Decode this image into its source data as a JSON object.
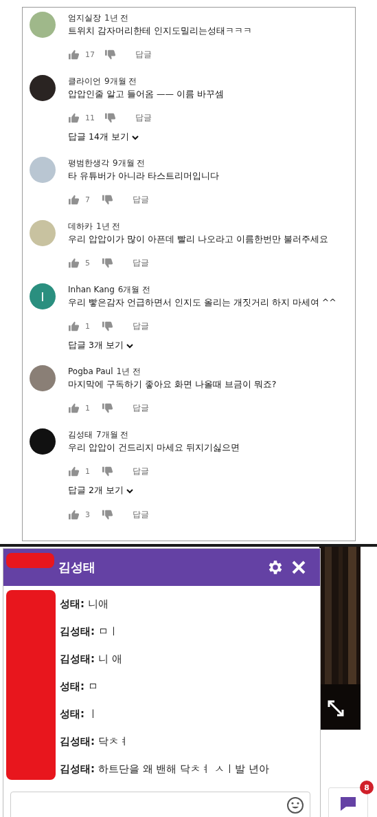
{
  "comments": [
    {
      "author": "엄지실장",
      "time": "1년 전",
      "text": "트위치 감자머리한테 인지도밀리는성태ㅋㅋㅋ",
      "avatar": {
        "color": "#9fb88a"
      },
      "likes": "17",
      "reply": "답글"
    },
    {
      "author": "클라이언",
      "time": "9개월 전",
      "text": "압압인줄 알고 들어옴 —— 이름 바꾸셈",
      "avatar": {
        "color": "#2a2422"
      },
      "likes": "11",
      "reply": "답글",
      "replies": "답글 14개 보기"
    },
    {
      "author": "평범한생각",
      "time": "9개월 전",
      "text": "타 유튜버가 아니라 타스트리머입니다",
      "avatar": {
        "color": "#b9c6d2"
      },
      "likes": "7",
      "reply": "답글"
    },
    {
      "author": "데하카",
      "time": "1년 전",
      "text": "우리 압압이가 많이 아픈데 빨리 나오라고 이름한번만 불러주세요",
      "avatar": {
        "color": "#c8c2a0"
      },
      "likes": "5",
      "reply": "답글"
    },
    {
      "author": "Inhan Kang",
      "time": "6개월 전",
      "text": "우리 빻은감자 언급하면서 인지도 올리는 개짓거리 하지 마세여 ^^",
      "avatar": {
        "color": "#2a8f7f",
        "letter": "I"
      },
      "likes": "1",
      "reply": "답글",
      "replies": "답글 3개 보기"
    },
    {
      "author": "Pogba Paul",
      "time": "1년 전",
      "text": "마지막에 구독하기 좋아요 화면 나올때 브금이 뭐죠?",
      "avatar": {
        "color": "#8a7f76"
      },
      "likes": "1",
      "reply": "답글"
    },
    {
      "author": "김성태",
      "time": "7개월 전",
      "text": "우리 압압이 건드리지 마세요 뒤지기싫으면",
      "avatar": {
        "color": "#111111"
      },
      "likes": "1",
      "reply": "답글",
      "replies": "답글 2개 보기"
    },
    {
      "likes": "3",
      "reply": "답글"
    }
  ],
  "whisper": {
    "title": "김성태",
    "messages": [
      {
        "sender": "성태:",
        "text": "니애"
      },
      {
        "sender": "김성태:",
        "text": "ㅁㅣ"
      },
      {
        "sender": "김성태:",
        "text": "니 애"
      },
      {
        "sender": "성태:",
        "text": "ㅁ"
      },
      {
        "sender": "성태:",
        "text": "ㅣ"
      },
      {
        "sender": "김성태:",
        "text": "닥ㅊㅕ"
      },
      {
        "sender": "김성태:",
        "text": "하트단을 왜 밴해 닥ㅊㅕ ㅅㅣ발 년아"
      }
    ]
  },
  "chat_badge": "8"
}
